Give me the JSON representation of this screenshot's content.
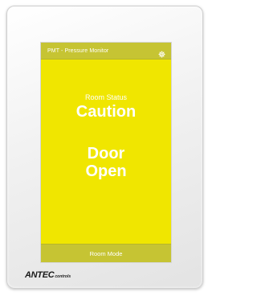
{
  "header": {
    "title": "PMT - Pressure Monitor",
    "settings_icon": "gear-icon"
  },
  "status": {
    "label": "Room Status",
    "value": "Caution",
    "message_line1": "Door",
    "message_line2": "Open"
  },
  "footer": {
    "mode_label": "Room Mode"
  },
  "brand": {
    "logo_main": "ANTEC",
    "logo_sub": "controls"
  },
  "colors": {
    "alert_yellow": "#f0e600",
    "bar_olive": "#c6c433",
    "text": "#ffffff"
  }
}
